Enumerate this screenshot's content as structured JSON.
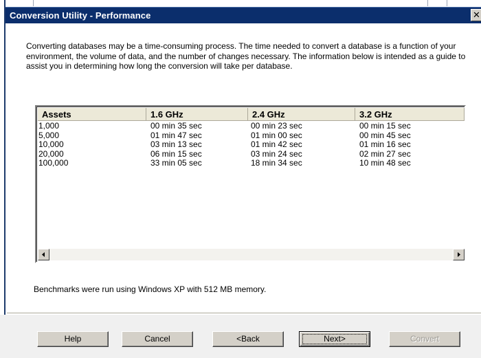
{
  "window": {
    "title": "Conversion Utility - Performance",
    "close_glyph": "✕"
  },
  "intro": {
    "text": "Converting databases may be a time-consuming process. The time needed to convert a database is a function of your environment, the volume of data, and the number of changes necessary. The information below is intended as a guide to assist you in determining how long the conversion will take per database."
  },
  "table": {
    "columns": [
      "Assets",
      "1.6 GHz",
      "2.4 GHz",
      "3.2 GHz"
    ],
    "rows": [
      [
        "1,000",
        "00 min 35 sec",
        "00 min 23 sec",
        "00 min 15 sec"
      ],
      [
        "5,000",
        "01 min 47 sec",
        "01 min 00 sec",
        "00 min 45 sec"
      ],
      [
        "10,000",
        "03 min 13 sec",
        "01 min 42 sec",
        "01 min 16 sec"
      ],
      [
        "20,000",
        "06 min 15 sec",
        "03 min 24 sec",
        "02 min 27 sec"
      ],
      [
        "100,000",
        "33 min 05 sec",
        "18 min 34 sec",
        "10 min 48 sec"
      ]
    ]
  },
  "footnote": "Benchmarks were run using Windows XP with 512 MB memory.",
  "buttons": {
    "help": "Help",
    "cancel": "Cancel",
    "back": "<Back",
    "next": "Next>",
    "convert": "Convert"
  },
  "icons": {
    "scroll_left": "scroll-left-icon",
    "scroll_right": "scroll-right-icon",
    "close": "close-icon"
  }
}
